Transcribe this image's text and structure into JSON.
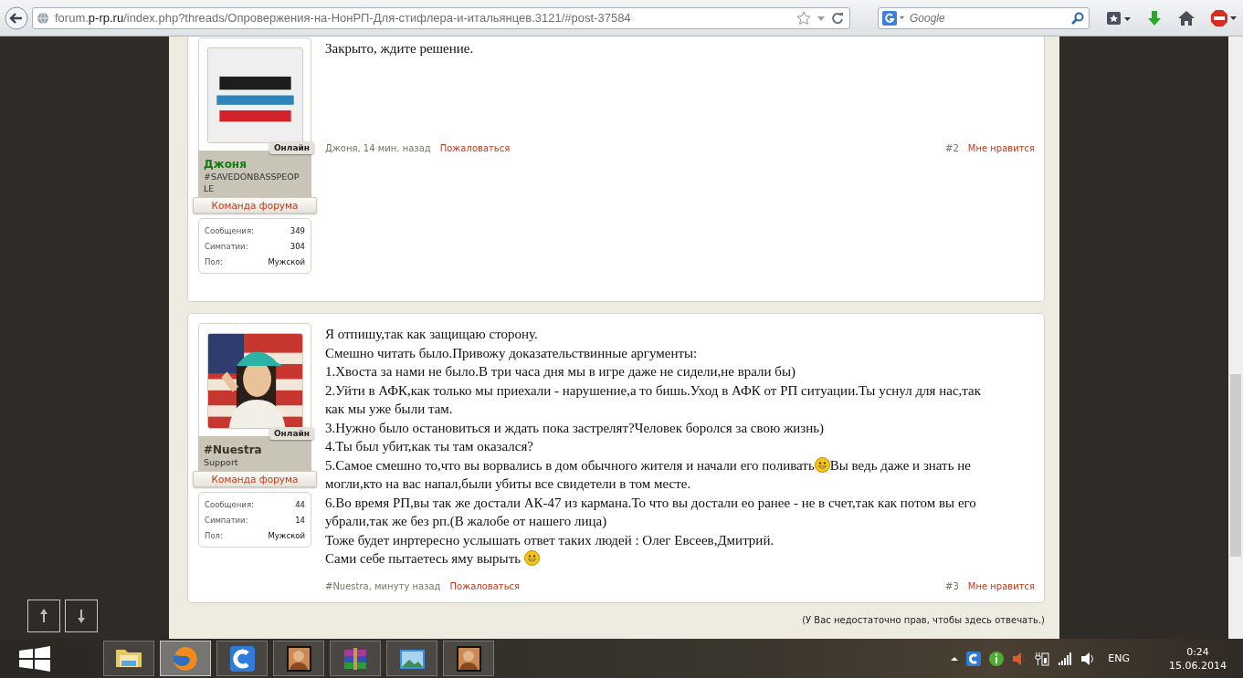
{
  "browser": {
    "address": {
      "prefix": "forum.",
      "domain": "p-rp.ru",
      "path": "/index.php?threads/Опровержения-на-НонРП-Для-стифлера-и-итальянцев.3121/#post-37584"
    },
    "search": {
      "placeholder": "Google"
    }
  },
  "posts": [
    {
      "user": {
        "name": "Джоня",
        "color": "#137a13",
        "title": "#SAVEDONBASSPEOPLE",
        "online": "Онлайн",
        "banner": "Команда форума",
        "stats": [
          {
            "label": "Сообщения:",
            "value": "349"
          },
          {
            "label": "Симпатии:",
            "value": "304"
          },
          {
            "label": "Пол:",
            "value": "Мужской"
          }
        ]
      },
      "message": [
        [
          {
            "kind": "text",
            "text": "Закрыто, ждите решение."
          }
        ]
      ],
      "meta": {
        "author_line": "Джоня, 14 мин. назад",
        "report": "Пожаловаться",
        "number": "#2",
        "like": "Мне нравится"
      }
    },
    {
      "user": {
        "name": "#Nuestra",
        "color": "#3a3324",
        "title": "Support",
        "online": "Онлайн",
        "banner": "Команда форума",
        "stats": [
          {
            "label": "Сообщения:",
            "value": "44"
          },
          {
            "label": "Симпатии:",
            "value": "14"
          },
          {
            "label": "Пол:",
            "value": "Мужской"
          }
        ]
      },
      "message": [
        [
          {
            "kind": "text",
            "text": "Я отпишу,так как защищаю сторону."
          }
        ],
        [
          {
            "kind": "text",
            "text": "Смешно читать было.Привожу доказательствинные аргументы:"
          }
        ],
        [
          {
            "kind": "text",
            "text": "1.Хвоста за нами не было.В три часа дня мы в игре даже не сидели,не врали бы)"
          }
        ],
        [
          {
            "kind": "text",
            "text": "2.Уйти в АФК,как только мы приехали - нарушение,а то бишь.Уход в АФК от РП ситуации.Ты уснул для нас,так"
          }
        ],
        [
          {
            "kind": "text",
            "text": "как мы уже были там."
          }
        ],
        [
          {
            "kind": "text",
            "text": "3.Нужно было остановиться и ждать пока застрелят?Человек боролся за свою жизнь)"
          }
        ],
        [
          {
            "kind": "text",
            "text": "4.Ты был убит,как ты там оказался?"
          }
        ],
        [
          {
            "kind": "text",
            "text": "5.Самое смешно то,что вы ворвались в дом обычного жителя и начали его поливать"
          },
          {
            "kind": "smiley"
          },
          {
            "kind": "text",
            "text": "Вы ведь даже и знать не"
          }
        ],
        [
          {
            "kind": "text",
            "text": "могли,кто на вас напал,были убиты все свидетели в том месте."
          }
        ],
        [
          {
            "kind": "text",
            "text": "6.Во время РП,вы так же достали АК-47 из кармана.То что вы достали ео ранее - не в счет,так как потом вы его"
          }
        ],
        [
          {
            "kind": "text",
            "text": "убрали,так же без рп.(В жалобе от нашего лица)"
          }
        ],
        [
          {
            "kind": "text",
            "text": "Тоже будет инртересно услышать ответ таких людей : Олег Евсеев,Дмитрий."
          }
        ],
        [
          {
            "kind": "text",
            "text": "Сами себе пытаетесь яму вырыть "
          },
          {
            "kind": "smiley"
          }
        ]
      ],
      "meta": {
        "author_line": "#Nuestra, минуту назад",
        "report": "Пожаловаться",
        "number": "#3",
        "like": "Мне нравится"
      }
    }
  ],
  "reply_notice": "(У Вас недостаточно прав, чтобы здесь отвечать.)",
  "taskbar": {
    "apps": [
      {
        "kind": "folder",
        "selected": false
      },
      {
        "kind": "browser",
        "selected": true
      },
      {
        "kind": "cloud",
        "selected": false
      },
      {
        "kind": "game",
        "selected": false
      },
      {
        "kind": "archive",
        "selected": false
      },
      {
        "kind": "photos",
        "selected": false
      },
      {
        "kind": "game",
        "selected": false
      }
    ]
  },
  "tray": {
    "language": "ENG",
    "time": "0:24",
    "date": "15.06.2014"
  }
}
